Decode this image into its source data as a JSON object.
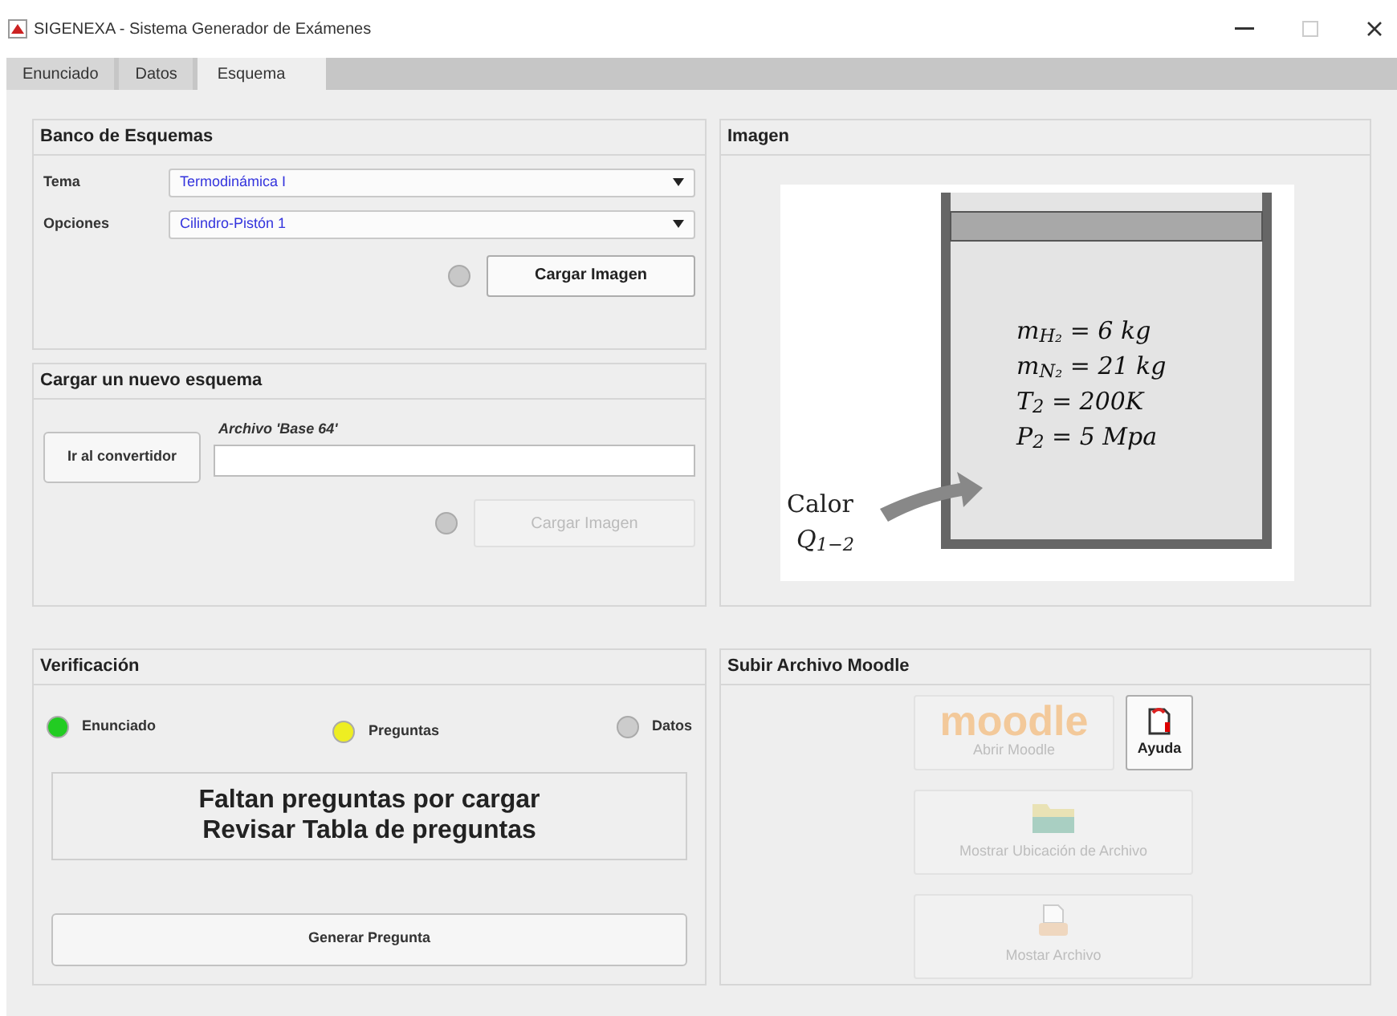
{
  "window": {
    "title": "SIGENEXA - Sistema Generador de Exámenes"
  },
  "tabs": [
    {
      "label": "Enunciado",
      "selected": false
    },
    {
      "label": "Datos",
      "selected": false
    },
    {
      "label": "Esquema",
      "selected": true
    }
  ],
  "banco": {
    "title": "Banco de Esquemas",
    "fields": [
      {
        "label": "Tema",
        "value": "Termodinámica I"
      },
      {
        "label": "Opciones",
        "value": "Cilindro-Pistón 1"
      }
    ],
    "lamp_lit": false,
    "button": {
      "label": "Cargar Imagen",
      "disabled": false
    }
  },
  "cargar": {
    "title": "Cargar un nuevo esquema",
    "converter_button": "Ir al convertidor",
    "file_label": "Archivo 'Base 64'",
    "lamp_lit": false,
    "button": {
      "label": "Cargar Imagen",
      "disabled": true
    }
  },
  "imagen": {
    "title": "Imagen",
    "diagram": {
      "lines": [
        "m$_{H₂}$ = 6 kg",
        "m$_{N₂}$ = 21 kg",
        "T$_{2}$ = 200K",
        "P$_{2}$ = 5 Mpa"
      ],
      "heat_label": "Calor",
      "heat_symbol": "Q$_{1−2}$"
    }
  },
  "verificacion": {
    "title": "Verificación",
    "indicators": [
      {
        "label": "Enunciado",
        "color": "#22cc22"
      },
      {
        "label": "Preguntas",
        "color": "#eeee22"
      },
      {
        "label": "Datos",
        "color": "#cccccc"
      }
    ],
    "message": [
      "Faltan preguntas por cargar",
      "Revisar Tabla de preguntas"
    ],
    "button": "Generar Pregunta"
  },
  "moodle": {
    "title": "Subir Archivo Moodle",
    "buttons": [
      {
        "kind": "moodle",
        "logo": "moodle",
        "label": "Abrir Moodle",
        "disabled": true
      },
      {
        "kind": "help",
        "label": "Ayuda",
        "disabled": false
      },
      {
        "kind": "folder",
        "label": "Mostrar Ubicación de Archivo",
        "disabled": true
      },
      {
        "kind": "file",
        "label": "Mostar Archivo",
        "disabled": true
      }
    ]
  }
}
